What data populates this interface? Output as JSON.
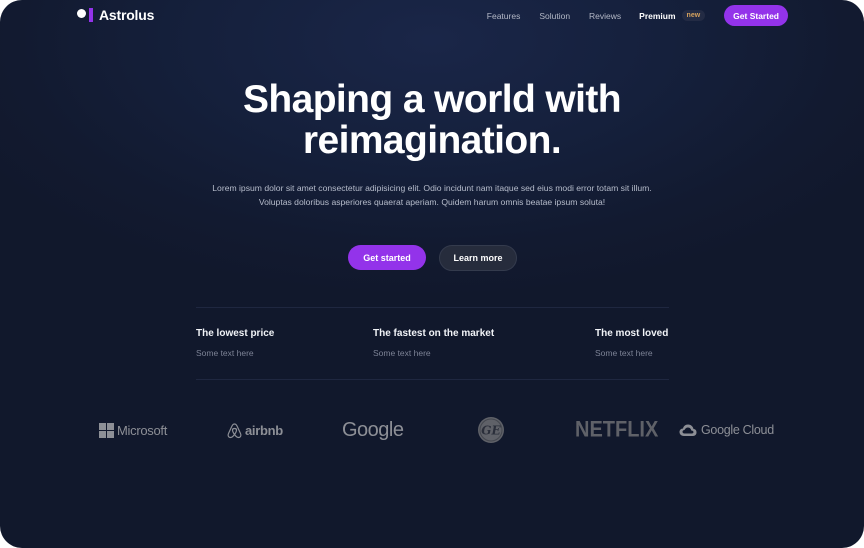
{
  "brand": {
    "name": "Astrolus",
    "accent": "#9333ea"
  },
  "nav": {
    "links": [
      "Features",
      "Solution",
      "Reviews"
    ],
    "premium_label": "Premium",
    "premium_badge": "new",
    "cta_label": "Get Started"
  },
  "hero": {
    "title_line1": "Shaping a world with",
    "title_line2": "reimagination.",
    "subtitle": "Lorem ipsum dolor sit amet consectetur adipisicing elit. Odio incidunt nam itaque sed eius modi error totam sit illum. Voluptas doloribus asperiores quaerat aperiam. Quidem harum omnis beatae ipsum soluta!",
    "primary_label": "Get started",
    "secondary_label": "Learn more"
  },
  "features": [
    {
      "title": "The lowest price",
      "text": "Some text here"
    },
    {
      "title": "The fastest on the market",
      "text": "Some text here"
    },
    {
      "title": "The most loved",
      "text": "Some text here"
    }
  ],
  "logos": {
    "microsoft": "Microsoft",
    "airbnb": "airbnb",
    "google": "Google",
    "ge": "GE",
    "netflix": "NETFLIX",
    "google_cloud": "Google Cloud"
  }
}
